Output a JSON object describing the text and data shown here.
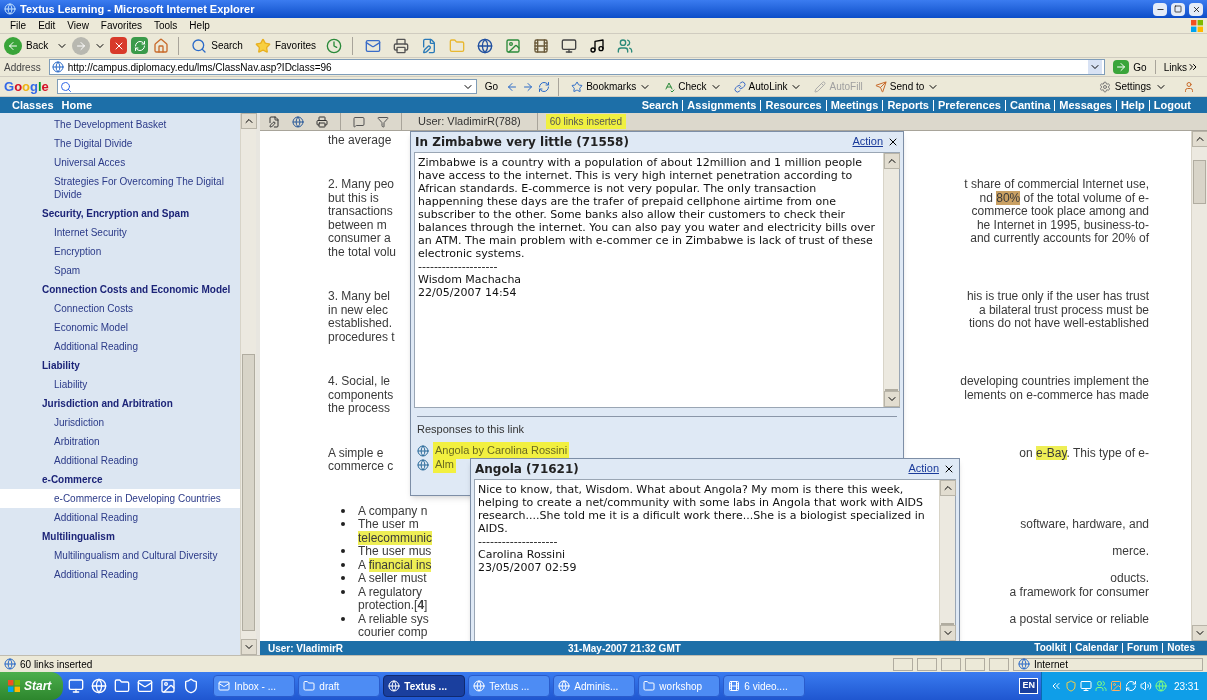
{
  "window": {
    "title": "Textus Learning - Microsoft Internet Explorer"
  },
  "menu": [
    "File",
    "Edit",
    "View",
    "Favorites",
    "Tools",
    "Help"
  ],
  "toolbar": {
    "back": "Back",
    "search": "Search",
    "favorites": "Favorites"
  },
  "address_bar": {
    "label": "Address",
    "url": "http://campus.diplomacy.edu/lms/ClassNav.asp?IDclass=96",
    "go": "Go",
    "links": "Links"
  },
  "google_toolbar": {
    "logo": "Google",
    "go": "Go",
    "buttons": [
      {
        "label": "Bookmarks",
        "kind": "bookmark",
        "dropdown": true,
        "disabled": false
      },
      {
        "label": "Check",
        "kind": "check",
        "dropdown": true,
        "disabled": false
      },
      {
        "label": "AutoLink",
        "kind": "link",
        "dropdown": true,
        "disabled": false
      },
      {
        "label": "AutoFill",
        "kind": "fill",
        "dropdown": false,
        "disabled": true
      },
      {
        "label": "Send to",
        "kind": "send",
        "dropdown": true,
        "disabled": false
      }
    ],
    "settings": "Settings"
  },
  "site_nav": {
    "left": [
      "Classes",
      "Home"
    ],
    "links": [
      "Search",
      "Assignments",
      "Resources",
      "Meetings",
      "Reports",
      "Preferences",
      "Cantina",
      "Messages",
      "Help",
      "Logout"
    ]
  },
  "sidebar": {
    "items": [
      {
        "label": "The Development Basket",
        "kind": "page",
        "selected": false
      },
      {
        "label": "The Digital Divide",
        "kind": "page",
        "selected": false
      },
      {
        "label": "Universal Acces",
        "kind": "page",
        "selected": false
      },
      {
        "label": "Strategies For Overcoming The Digital Divide",
        "kind": "page",
        "selected": false
      },
      {
        "label": "Security, Encryption and Spam",
        "kind": "section",
        "selected": false,
        "children": [
          {
            "label": "Internet Security",
            "kind": "page",
            "selected": false
          },
          {
            "label": "Encryption",
            "kind": "page",
            "selected": false
          },
          {
            "label": "Spam",
            "kind": "page",
            "selected": false
          }
        ]
      },
      {
        "label": "Connection Costs and Economic Model",
        "kind": "section",
        "selected": false,
        "children": [
          {
            "label": "Connection Costs",
            "kind": "page",
            "selected": false
          },
          {
            "label": "Economic Model",
            "kind": "page",
            "selected": false
          },
          {
            "label": "Additional Reading",
            "kind": "page",
            "selected": false
          }
        ]
      },
      {
        "label": "Liability",
        "kind": "section",
        "selected": false,
        "children": [
          {
            "label": "Liability",
            "kind": "page",
            "selected": false
          }
        ]
      },
      {
        "label": "Jurisdiction and Arbitration",
        "kind": "section",
        "selected": false,
        "children": [
          {
            "label": "Jurisdiction",
            "kind": "page",
            "selected": false
          },
          {
            "label": "Arbitration",
            "kind": "page",
            "selected": false
          },
          {
            "label": "Additional Reading",
            "kind": "page",
            "selected": false
          }
        ]
      },
      {
        "label": "e-Commerce",
        "kind": "section",
        "selected": false,
        "children": [
          {
            "label": "e-Commerce in Developing Countries",
            "kind": "page",
            "selected": true
          },
          {
            "label": "Additional Reading",
            "kind": "page",
            "selected": false
          }
        ]
      },
      {
        "label": "Multilingualism",
        "kind": "section",
        "selected": false,
        "children": [
          {
            "label": "Multilingualism and Cultural Diversity",
            "kind": "page",
            "selected": false
          },
          {
            "label": "Additional Reading",
            "kind": "page",
            "selected": false
          }
        ]
      }
    ]
  },
  "main_toolbar": {
    "user": "User: VladimirR(788)",
    "notice": "60 links inserted"
  },
  "article": {
    "blocks": [
      {
        "kind": "paragraph",
        "lines": [
          {
            "left": "the average"
          }
        ]
      },
      {
        "kind": "paragraph",
        "lines": [
          {
            "left": "2. Many peo",
            "right": "t share of commercial Internet use,"
          },
          {
            "left": "but this is",
            "right": [
              {
                "text": "nd ",
                "highlighted": false
              },
              {
                "text": "80%",
                "highlighted": true,
                "color": "#c9a063"
              },
              {
                "text": " of the total volume of e-",
                "highlighted": false
              }
            ]
          },
          {
            "left": "transactions",
            "right": "commerce took place among and"
          },
          {
            "left": "between m",
            "right": "he Internet in 1995, business-to-"
          },
          {
            "left": "consumer a",
            "right": "and currently accounts for 20% of"
          },
          {
            "left": "the total volu"
          }
        ]
      },
      {
        "kind": "paragraph",
        "lines": [
          {
            "left": "3. Many bel",
            "right": "his is true only if the user has trust"
          },
          {
            "left": "in new elec",
            "right": "a bilateral trust process must be"
          },
          {
            "left": "established.",
            "right": "tions do not have well-established"
          },
          {
            "left": "procedures t"
          }
        ]
      },
      {
        "kind": "paragraph",
        "lines": [
          {
            "left": "4. Social, le",
            "right": "developing countries implement the"
          },
          {
            "left": "components",
            "right": "lements on e-commerce has made"
          },
          {
            "left": "the process"
          }
        ]
      },
      {
        "kind": "paragraph",
        "lines": [
          {
            "left": "A simple e",
            "right": [
              {
                "text": "on ",
                "highlighted": false
              },
              {
                "text": "e-Bay",
                "highlighted": true,
                "color": "#eeee55"
              },
              {
                "text": ". This type of e-",
                "highlighted": false
              }
            ]
          },
          {
            "left": "commerce c"
          }
        ]
      },
      {
        "kind": "list",
        "items": [
          {
            "lines": [
              {
                "left": "A company n"
              }
            ]
          },
          {
            "lines": [
              {
                "left": "The user m",
                "right": "software, hardware, and"
              },
              {
                "left": [
                  {
                    "text": "telecommunic",
                    "highlighted": true,
                    "color": "#eeee55"
                  }
                ]
              }
            ]
          },
          {
            "lines": [
              {
                "left": "The user mus",
                "right": "merce."
              }
            ]
          },
          {
            "lines": [
              {
                "left": [
                  {
                    "text": "A ",
                    "highlighted": false
                  },
                  {
                    "text": "financial ins",
                    "highlighted": true,
                    "color": "#eeee55"
                  }
                ]
              }
            ]
          },
          {
            "lines": [
              {
                "left": "A seller must",
                "right": "oducts."
              }
            ]
          },
          {
            "lines": [
              {
                "left": "A regulatory",
                "right": "a framework for consumer"
              },
              {
                "left": "protection.[**4**]"
              }
            ]
          },
          {
            "lines": [
              {
                "left": "A reliable sys",
                "right": "a postal service or reliable"
              },
              {
                "left": "courier comp"
              }
            ]
          }
        ]
      }
    ]
  },
  "popups": [
    {
      "title": "In Zimbabwe very little (71558)",
      "action": "Action",
      "body": "Zimbabwe is a country with a population of about 12million and 1 million people have access to the internet. This is very high internet penetration according to African standards. E-commerce is not very popular. The only transaction happenning these days are the trafer of prepaid cellphone airtime from one subscriber to the other. Some banks also allow their customers to check their balances through the internet. You can also pay you water and electricity bills over an ATM. The main problem with e-commer ce in Zimbabwe is lack of trust of these electronic systems.",
      "rule": "--------------------",
      "author": "Wisdom Machacha",
      "date": "22/05/2007 14:54",
      "responses_heading": "Responses to this link",
      "responses": [
        {
          "label": "Angola by Carolina Rossini",
          "highlighted": true
        },
        {
          "label": "Alm",
          "highlighted": true
        }
      ]
    },
    {
      "title": "Angola (71621)",
      "action": "Action",
      "body": "Nice to know, that, Wisdom. What about Angola? My mom is there this week, helping to create a net/community with some labs in Angola that work with AIDS research....She told me it is a dificult work there...She is a biologist specialized in AIDS.",
      "rule": "--------------------",
      "author": "Carolina Rossini",
      "date": "23/05/2007 02:59"
    }
  ],
  "footer_bar": {
    "user": "User: VladimirR",
    "datetime": "31-May-2007 21:32 GMT",
    "links": [
      "Toolkit",
      "Calendar",
      "Forum",
      "Notes"
    ]
  },
  "status_bar": {
    "message": "60 links inserted",
    "zone": "Internet"
  },
  "taskbar": {
    "start": "Start",
    "tasks": [
      {
        "label": "Inbox - ...",
        "kind": "mail",
        "selected": false
      },
      {
        "label": "draft",
        "kind": "folder",
        "selected": false
      },
      {
        "label": "Textus ...",
        "kind": "browser",
        "selected": true
      },
      {
        "label": "Textus ...",
        "kind": "browser",
        "selected": false
      },
      {
        "label": "Adminis...",
        "kind": "browser",
        "selected": false
      },
      {
        "label": "workshop",
        "kind": "folder",
        "selected": false
      },
      {
        "label": "6 video....",
        "kind": "video",
        "selected": false
      }
    ],
    "language": "EN",
    "clock": "23:31"
  }
}
